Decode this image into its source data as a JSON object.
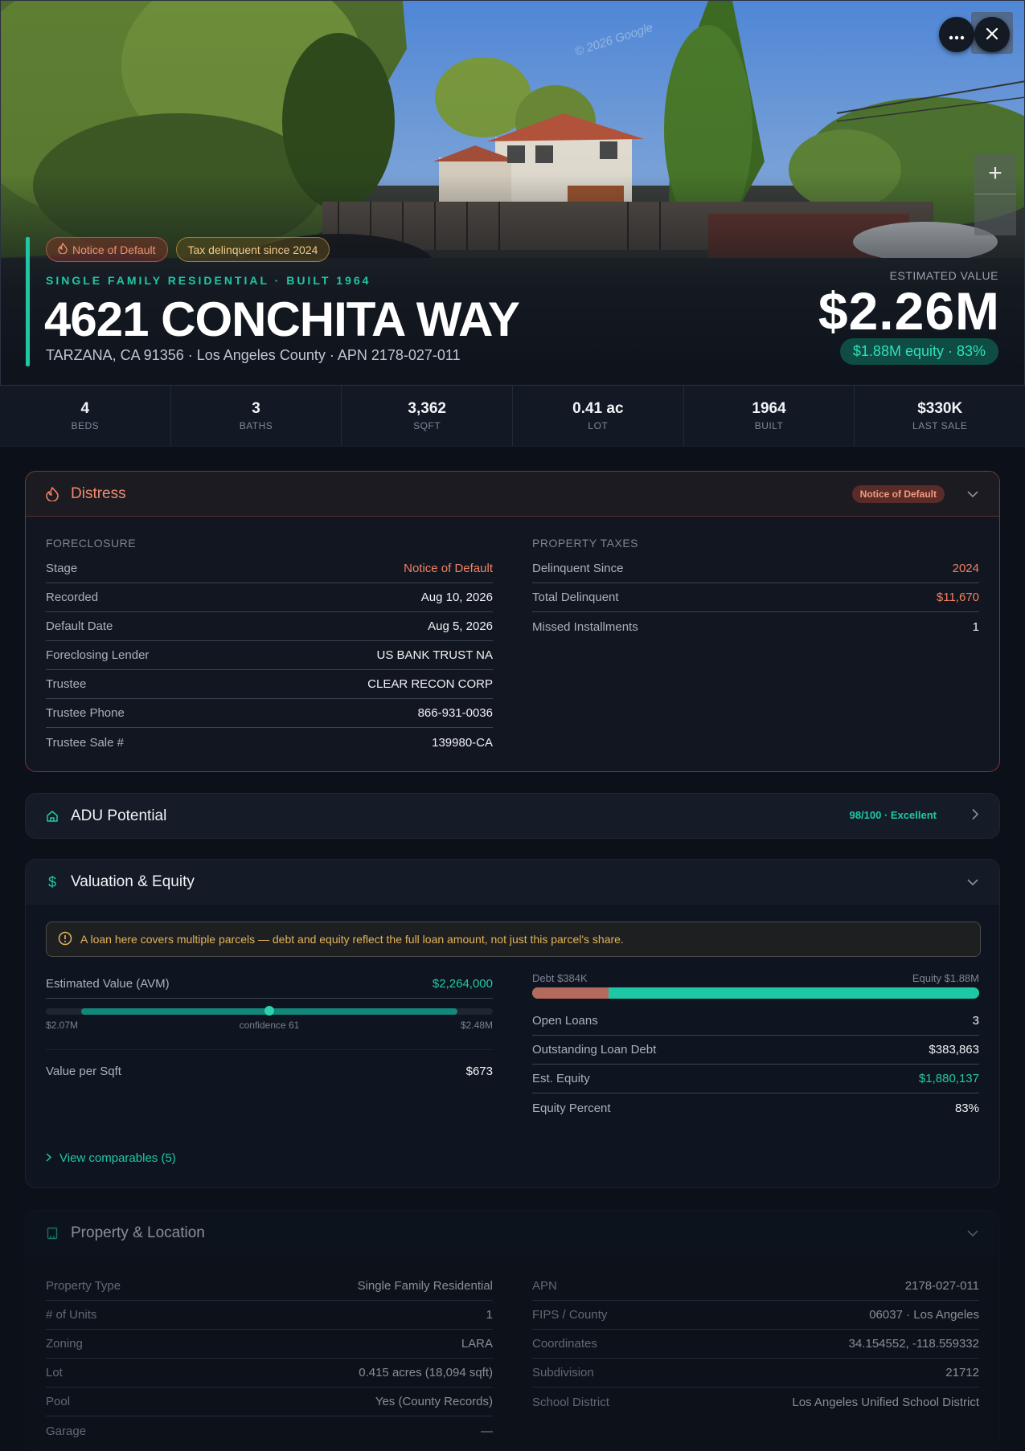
{
  "hero": {
    "badges": [
      "Notice of Default",
      "Tax delinquent since 2024"
    ],
    "subtitle": "SINGLE FAMILY RESIDENTIAL · BUILT 1964",
    "address": "4621 CONCHITA WAY",
    "address_sub": "TARZANA, CA 91356 · Los Angeles County · APN 2178-027-011",
    "est_label": "ESTIMATED VALUE",
    "est_value": "$2.26M",
    "equity": "$1.88M equity · 83%",
    "watermark": "© 2026 Google",
    "icons": [
      "more-icon",
      "close-icon",
      "zoom-in-icon"
    ]
  },
  "stats": [
    {
      "value": "4",
      "label": "BEDS"
    },
    {
      "value": "3",
      "label": "BATHS"
    },
    {
      "value": "3,362",
      "label": "SQFT"
    },
    {
      "value": "0.41 ac",
      "label": "LOT"
    },
    {
      "value": "1964",
      "label": "BUILT"
    },
    {
      "value": "$330K",
      "label": "LAST SALE"
    }
  ],
  "distress": {
    "title": "Distress",
    "badge": "Notice of Default",
    "foreclosure_label": "FORECLOSURE",
    "foreclosure": [
      {
        "k": "Stage",
        "v": "Notice of Default"
      },
      {
        "k": "Recorded",
        "v": "Aug 10, 2026"
      },
      {
        "k": "Default Date",
        "v": "Aug 5, 2026"
      },
      {
        "k": "Foreclosing Lender",
        "v": "US BANK TRUST NA"
      },
      {
        "k": "Trustee",
        "v": "CLEAR RECON CORP"
      },
      {
        "k": "Trustee Phone",
        "v": "866-931-0036"
      },
      {
        "k": "Trustee Sale #",
        "v": "139980-CA"
      }
    ],
    "taxes_label": "PROPERTY TAXES",
    "taxes": [
      {
        "k": "Delinquent Since",
        "v": "2024"
      },
      {
        "k": "Total Delinquent",
        "v": "$11,670"
      },
      {
        "k": "Missed Installments",
        "v": "1"
      }
    ]
  },
  "adu": {
    "title": "ADU Potential",
    "score": "98/100 · Excellent"
  },
  "valuation": {
    "title": "Valuation & Equity",
    "warning": "A loan here covers multiple parcels — debt and equity reflect the full loan amount, not just this parcel's share.",
    "avm_label": "Estimated Value (AVM)",
    "avm_value": "$2,264,000",
    "range_low": "$2.07M",
    "range_mid": "confidence 61",
    "range_high": "$2.48M",
    "range_position": 0.5,
    "value_sqft_label": "Value per Sqft",
    "value_sqft": "$673",
    "debt_label": "Debt $384K",
    "equity_label": "Equity $1.88M",
    "debt_fraction": 0.17,
    "rows": [
      {
        "k": "Open Loans",
        "v": "3"
      },
      {
        "k": "Outstanding Loan Debt",
        "v": "$383,863"
      },
      {
        "k": "Est. Equity",
        "v": "$1,880,137"
      },
      {
        "k": "Equity Percent",
        "v": "83%"
      }
    ],
    "comps": "View comparables (5)"
  },
  "property": {
    "title": "Property & Location",
    "left": [
      {
        "k": "Property Type",
        "v": "Single Family Residential"
      },
      {
        "k": "# of Units",
        "v": "1"
      },
      {
        "k": "Zoning",
        "v": "LARA"
      },
      {
        "k": "Lot",
        "v": "0.415 acres (18,094 sqft)"
      },
      {
        "k": "Pool",
        "v": "Yes (County Records)"
      },
      {
        "k": "Garage",
        "v": "—"
      }
    ],
    "right": [
      {
        "k": "APN",
        "v": "2178-027-011"
      },
      {
        "k": "FIPS / County",
        "v": "06037 · Los Angeles"
      },
      {
        "k": "Coordinates",
        "v": "34.154552, -118.559332"
      },
      {
        "k": "Subdivision",
        "v": "21712"
      },
      {
        "k": "School District",
        "v": "Los Angeles Unified School District"
      }
    ]
  },
  "colors": {
    "accent": "#1ec8a5",
    "distress": "#f08163",
    "background": "#0b1019"
  }
}
